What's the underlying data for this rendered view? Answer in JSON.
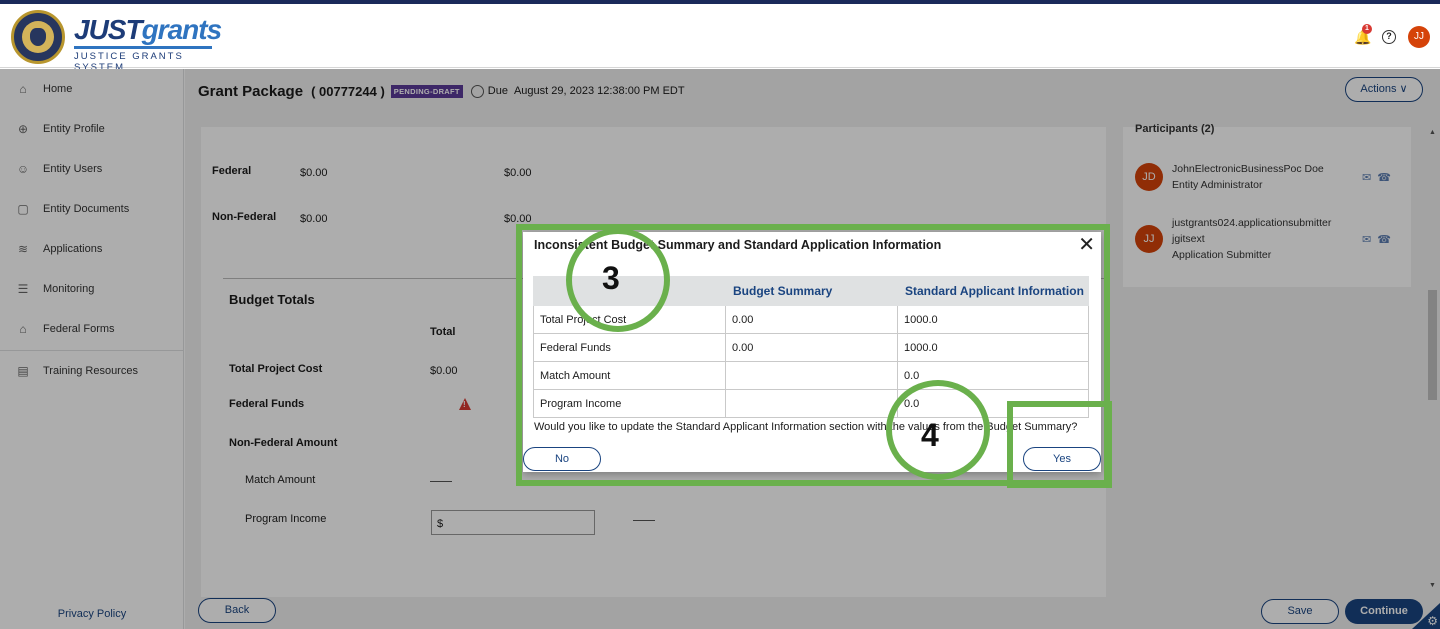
{
  "header": {
    "brand_main_1": "JUST",
    "brand_main_2": "grants",
    "brand_sub": "JUSTICE GRANTS SYSTEM",
    "notif_count": "1",
    "help_glyph": "?",
    "user_initials": "JJ"
  },
  "sidebar": {
    "items": [
      {
        "label": "Home",
        "icon": "home-icon",
        "glyph": "⌂"
      },
      {
        "label": "Entity Profile",
        "icon": "globe-icon",
        "glyph": "⊕"
      },
      {
        "label": "Entity Users",
        "icon": "users-icon",
        "glyph": "☺"
      },
      {
        "label": "Entity Documents",
        "icon": "document-icon",
        "glyph": "▢"
      },
      {
        "label": "Applications",
        "icon": "layers-icon",
        "glyph": "≋"
      },
      {
        "label": "Monitoring",
        "icon": "list-icon",
        "glyph": "☰"
      },
      {
        "label": "Federal Forms",
        "icon": "bank-icon",
        "glyph": "⌂"
      },
      {
        "label": "Training Resources",
        "icon": "book-icon",
        "glyph": "▤"
      }
    ],
    "privacy": "Privacy Policy"
  },
  "page": {
    "title": "Grant Package",
    "number": "( 00777244 )",
    "status": "PENDING-DRAFT",
    "due_label": "Due",
    "due_date": "August 29, 2023 12:38:00 PM EDT",
    "actions_label": "Actions"
  },
  "content": {
    "federal_label": "Federal",
    "federal_v1": "$0.00",
    "federal_v2": "$0.00",
    "nonfederal_label": "Non-Federal",
    "nonfederal_v1": "$0.00",
    "nonfederal_v2": "$0.00",
    "budget_totals": "Budget Totals",
    "total_header": "Total",
    "total_project_cost": "Total Project Cost",
    "total_project_cost_value": "$0.00",
    "federal_funds": "Federal Funds",
    "non_federal_amount": "Non-Federal Amount",
    "match_amount": "Match Amount",
    "program_income": "Program Income",
    "program_income_placeholder": "$"
  },
  "participants": {
    "title": "Participants (2)",
    "people": [
      {
        "initials": "JD",
        "name": "JohnElectronicBusinessPoc Doe",
        "role": "Entity Administrator"
      },
      {
        "initials": "JJ",
        "name": "justgrants024.applicationsubmitter",
        "name2": "jgitsext",
        "role": "Application Submitter"
      }
    ]
  },
  "footer": {
    "back": "Back",
    "save": "Save",
    "continue": "Continue"
  },
  "modal": {
    "title": "Inconsistent Budget Summary and Standard Application Information",
    "col_budget": "Budget Summary",
    "col_standard": "Standard Applicant Information",
    "rows": [
      {
        "label": "Total Project Cost",
        "budget": "0.00",
        "standard": "1000.0"
      },
      {
        "label": "Federal Funds",
        "budget": "0.00",
        "standard": "1000.0"
      },
      {
        "label": "Match Amount",
        "budget": "",
        "standard": "0.0"
      },
      {
        "label": "Program Income",
        "budget": "",
        "standard": "0.0"
      }
    ],
    "question": "Would you like to update the Standard Applicant Information section with the values from the Budget Summary?",
    "no": "No",
    "yes": "Yes"
  },
  "annotations": {
    "step3": "3",
    "step4": "4",
    "color": "#6ab04c"
  }
}
